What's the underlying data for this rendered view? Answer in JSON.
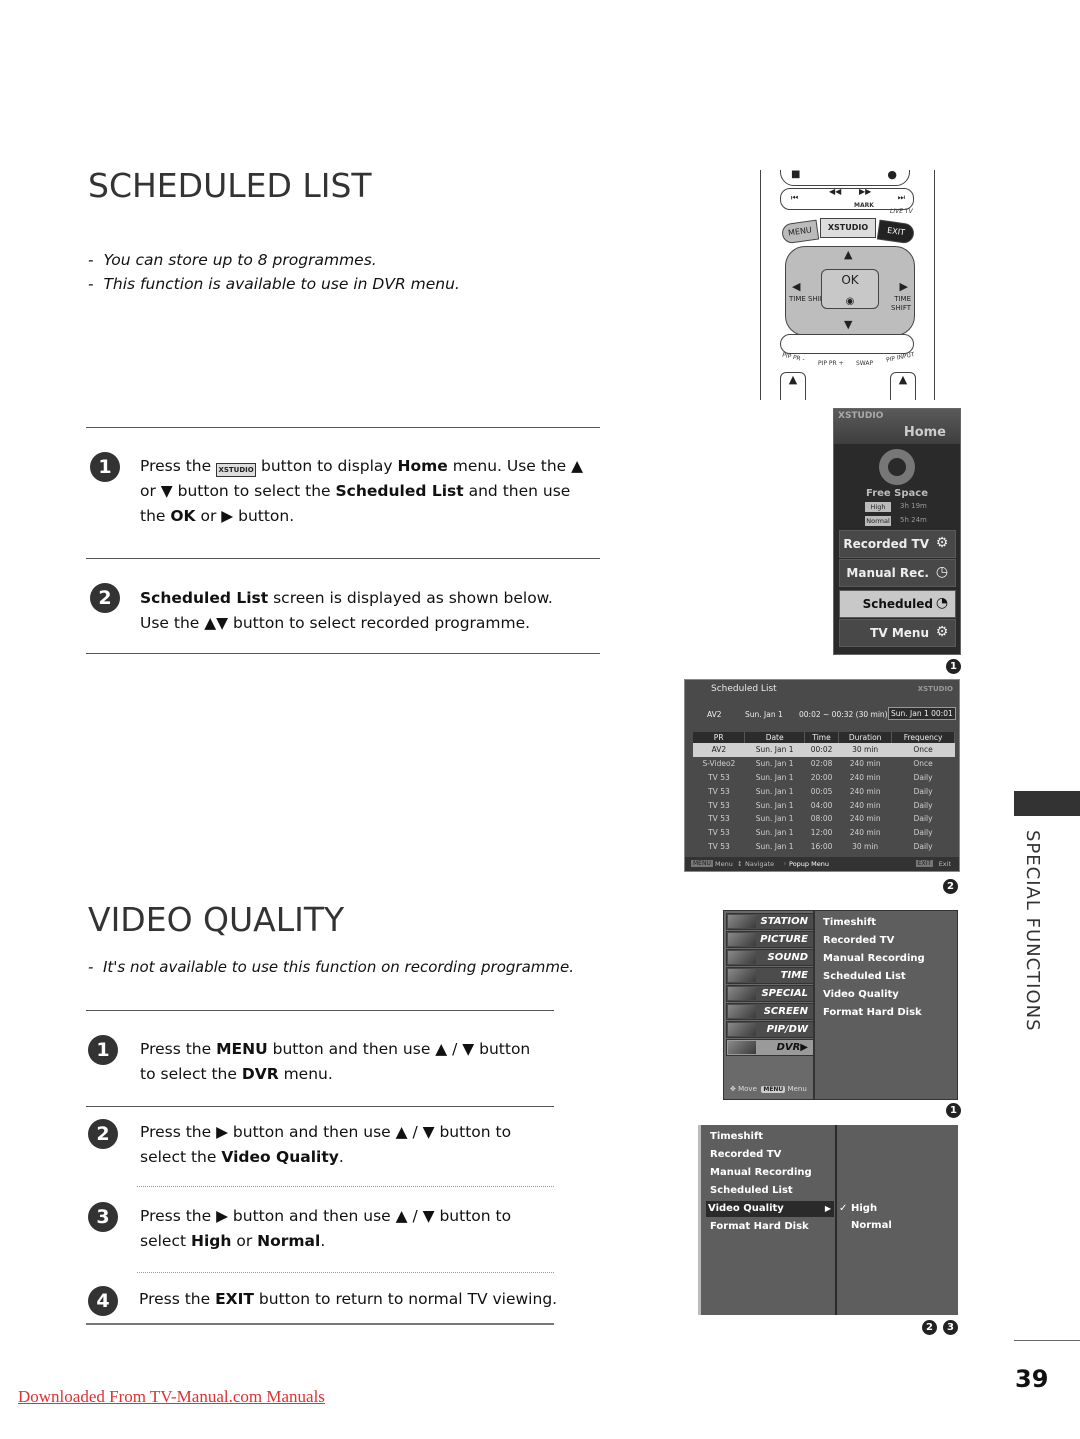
{
  "scheduled_list": {
    "heading": "SCHEDULED LIST",
    "notes": [
      "You can store up to 8 programmes.",
      "This function is available to use in DVR menu."
    ],
    "steps": [
      {
        "num": "1",
        "parts": [
          {
            "t": "Press the ",
            "b": false
          },
          {
            "t": "",
            "b": false,
            "key": "XSTUDIO"
          },
          {
            "t": " button to display ",
            "b": false
          },
          {
            "t": "Home",
            "b": true
          },
          {
            "t": " menu. Use the ▲ or ▼ button to select the ",
            "b": false
          },
          {
            "t": "Scheduled List",
            "b": true
          },
          {
            "t": " and then use the ",
            "b": false
          },
          {
            "t": "OK",
            "b": true
          },
          {
            "t": " or ▶ button.",
            "b": false
          }
        ]
      },
      {
        "num": "2",
        "parts": [
          {
            "t": "Scheduled List",
            "b": true
          },
          {
            "t": " screen is displayed as shown below. Use the  ▲▼ button to select recorded programme.",
            "b": false
          }
        ]
      }
    ]
  },
  "video_quality": {
    "heading": "VIDEO QUALITY",
    "note": "It's not available to use this function on recording programme.",
    "steps": [
      {
        "num": "1",
        "parts": [
          {
            "t": "Press the ",
            "b": false
          },
          {
            "t": "MENU",
            "b": true
          },
          {
            "t": " button and  then use ▲ / ▼ button to select the ",
            "b": false
          },
          {
            "t": "DVR",
            "b": true
          },
          {
            "t": " menu.",
            "b": false
          }
        ]
      },
      {
        "num": "2",
        "parts": [
          {
            "t": "Press the ▶ button and then use ▲ / ▼ button to select the ",
            "b": false
          },
          {
            "t": "Video Quality",
            "b": true
          },
          {
            "t": ".",
            "b": false
          }
        ]
      },
      {
        "num": "3",
        "parts": [
          {
            "t": "Press the ▶ button and then use ▲ / ▼ button to select ",
            "b": false
          },
          {
            "t": "High",
            "b": true
          },
          {
            "t": " or ",
            "b": false
          },
          {
            "t": "Normal",
            "b": true
          },
          {
            "t": ".",
            "b": false
          }
        ]
      },
      {
        "num": "4",
        "parts": [
          {
            "t": "Press the ",
            "b": false
          },
          {
            "t": "EXIT",
            "b": true
          },
          {
            "t": " button to return to normal TV viewing.",
            "b": false
          }
        ]
      }
    ]
  },
  "remote": {
    "menu": "MENU",
    "xstudio": "XSTUDIO",
    "exit": "EXIT",
    "ok": "OK",
    "mark": "MARK",
    "live_tv": "LIVE TV",
    "time_shift": "TIME SHIFT",
    "pip_pr_minus": "PIP PR -",
    "pip_pr_plus": "PIP PR +",
    "swap": "SWAP",
    "pip_input": "PIP INPUT"
  },
  "home_menu": {
    "logo": "XSTUDIO",
    "title": "Home",
    "free_space_label": "Free Space",
    "free_space": [
      {
        "quality": "High",
        "time": "3h  19m"
      },
      {
        "quality": "Normal",
        "time": "5h  24m"
      }
    ],
    "items": [
      {
        "label": "Recorded TV",
        "icon": "film-reel-icon",
        "selected": false
      },
      {
        "label": "Manual Rec.",
        "icon": "clock-record-icon",
        "selected": false
      },
      {
        "label": "Scheduled List",
        "icon": "schedule-clock-icon",
        "selected": true
      },
      {
        "label": "TV Menu",
        "icon": "gears-icon",
        "selected": false
      }
    ],
    "badge": "1"
  },
  "scheduled_screen": {
    "title": "Scheduled List",
    "logo": "XSTUDIO",
    "current": {
      "pr": "AV2",
      "date": "Sun.  Jan  1",
      "time": "00:02  ~  00:32  (30 min)",
      "clock": "Sun.  Jan  1  00:01"
    },
    "columns": [
      "PR",
      "Date",
      "Time",
      "Duration",
      "Frequency"
    ],
    "rows": [
      [
        "AV2",
        "Sun. Jan 1",
        "00:02",
        "30 min",
        "Once"
      ],
      [
        "S-Video2",
        "Sun. Jan 1",
        "02:08",
        "240 min",
        "Once"
      ],
      [
        "TV 53",
        "Sun. Jan 1",
        "20:00",
        "240 min",
        "Daily"
      ],
      [
        "TV 53",
        "Sun. Jan 1",
        "00:05",
        "240 min",
        "Daily"
      ],
      [
        "TV 53",
        "Sun. Jan 1",
        "04:00",
        "240 min",
        "Daily"
      ],
      [
        "TV 53",
        "Sun. Jan 1",
        "08:00",
        "240 min",
        "Daily"
      ],
      [
        "TV 53",
        "Sun. Jan 1",
        "12:00",
        "240 min",
        "Daily"
      ],
      [
        "TV 53",
        "Sun. Jan 1",
        "16:00",
        "30 min",
        "Daily"
      ]
    ],
    "selected_row": 0,
    "footer": {
      "menu": "Menu",
      "navigate": "Navigate",
      "popup": "Popup Menu",
      "exit": "Exit",
      "menu_key": "MENU",
      "exit_key": "EXIT"
    },
    "badge": "2"
  },
  "dvr_menu": {
    "categories": [
      "STATION",
      "PICTURE",
      "SOUND",
      "TIME",
      "SPECIAL",
      "SCREEN",
      "PIP/DW",
      "DVR▶"
    ],
    "active_category": 7,
    "items": [
      "Timeshift",
      "Recorded TV",
      "Manual Recording",
      "Scheduled List",
      "Video Quality",
      "Format Hard Disk"
    ],
    "footer_move": "Move",
    "footer_menu_key": "MENU",
    "footer_menu": "Menu",
    "badge": "1"
  },
  "vq_menu": {
    "items": [
      "Timeshift",
      "Recorded TV",
      "Manual Recording",
      "Scheduled List",
      "Video Quality",
      "Format Hard Disk"
    ],
    "selected": 4,
    "options": [
      {
        "label": "High",
        "checked": true
      },
      {
        "label": "Normal",
        "checked": false
      }
    ],
    "badges": [
      "2",
      "3"
    ]
  },
  "side_section": "SPECIAL FUNCTIONS",
  "page_number": "39",
  "download_link": "Downloaded From TV-Manual.com Manuals"
}
